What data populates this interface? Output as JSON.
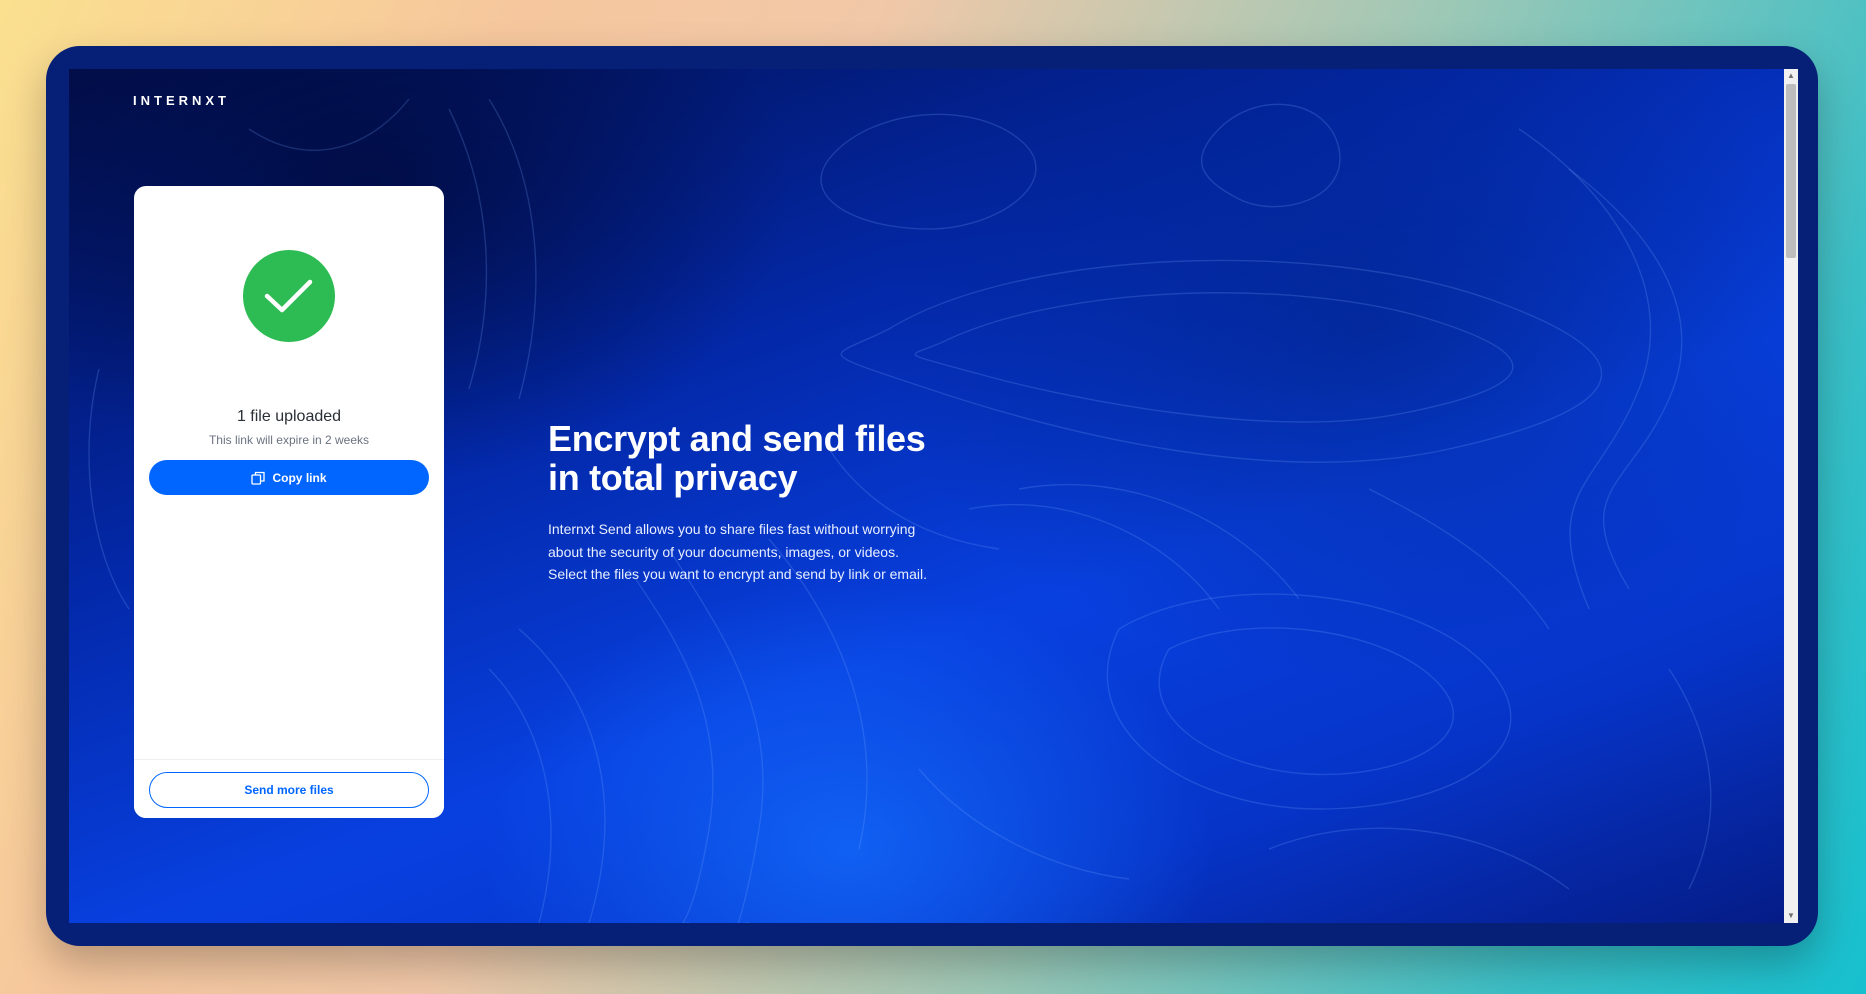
{
  "header": {
    "logo_text": "INTERNXT"
  },
  "upload_card": {
    "status_icon": "checkmark-circle-icon",
    "title": "1 file uploaded",
    "subtitle": "This link will expire in 2 weeks",
    "copy_button": {
      "icon": "copy-icon",
      "label": "Copy link"
    },
    "send_more_label": "Send more files"
  },
  "hero": {
    "title_lines": [
      "Encrypt and send files",
      "in total privacy"
    ],
    "description_lines": [
      "Internxt Send allows you to share files fast without worrying",
      "about the security of your documents, images, or videos.",
      "Select the files you want to encrypt and send by link or email."
    ]
  },
  "colors": {
    "primary_blue": "#0066ff",
    "success_green": "#2dbb54",
    "frame_navy": "#062077"
  }
}
